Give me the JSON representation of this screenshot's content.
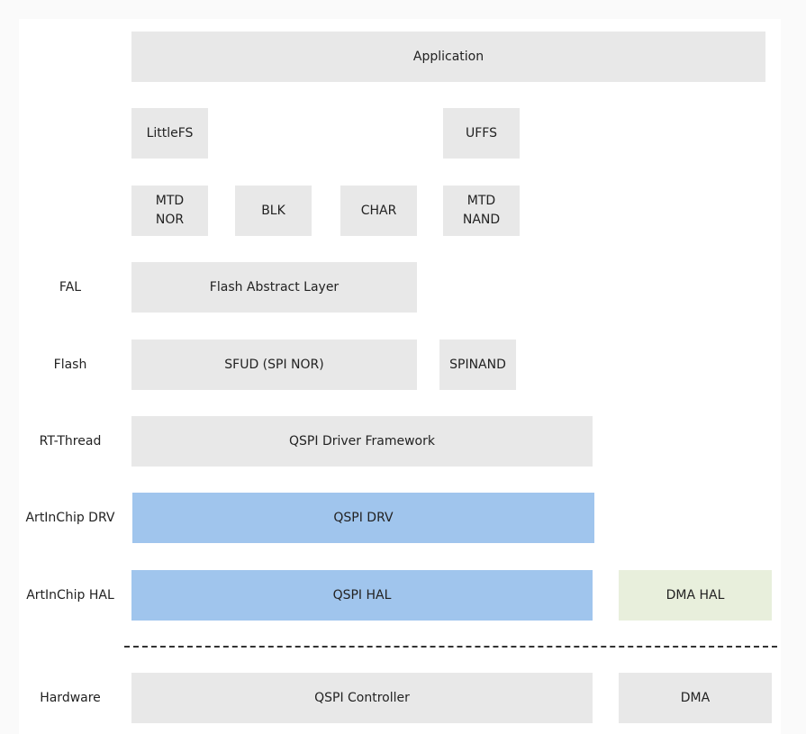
{
  "layers": {
    "application": "Application",
    "littlefs": "LittleFS",
    "uffs": "UFFS",
    "mtd_nor": "MTD\nNOR",
    "blk": "BLK",
    "char": "CHAR",
    "mtd_nand": "MTD\nNAND",
    "fal": "Flash Abstract Layer",
    "sfud": "SFUD (SPI NOR)",
    "spinand": "SPINAND",
    "qspi_framework": "QSPI Driver Framework",
    "qspi_drv": "QSPI DRV",
    "qspi_hal": "QSPI HAL",
    "dma_hal": "DMA HAL",
    "qspi_controller": "QSPI Controller",
    "dma": "DMA"
  },
  "row_labels": {
    "fal": "FAL",
    "flash": "Flash",
    "rtthread": "RT-Thread",
    "drv": "ArtInChip DRV",
    "hal": "ArtInChip HAL",
    "hardware": "Hardware"
  },
  "colors": {
    "gray": "#e8e8e8",
    "blue": "#a0c5ed",
    "green": "#e8efdc"
  }
}
